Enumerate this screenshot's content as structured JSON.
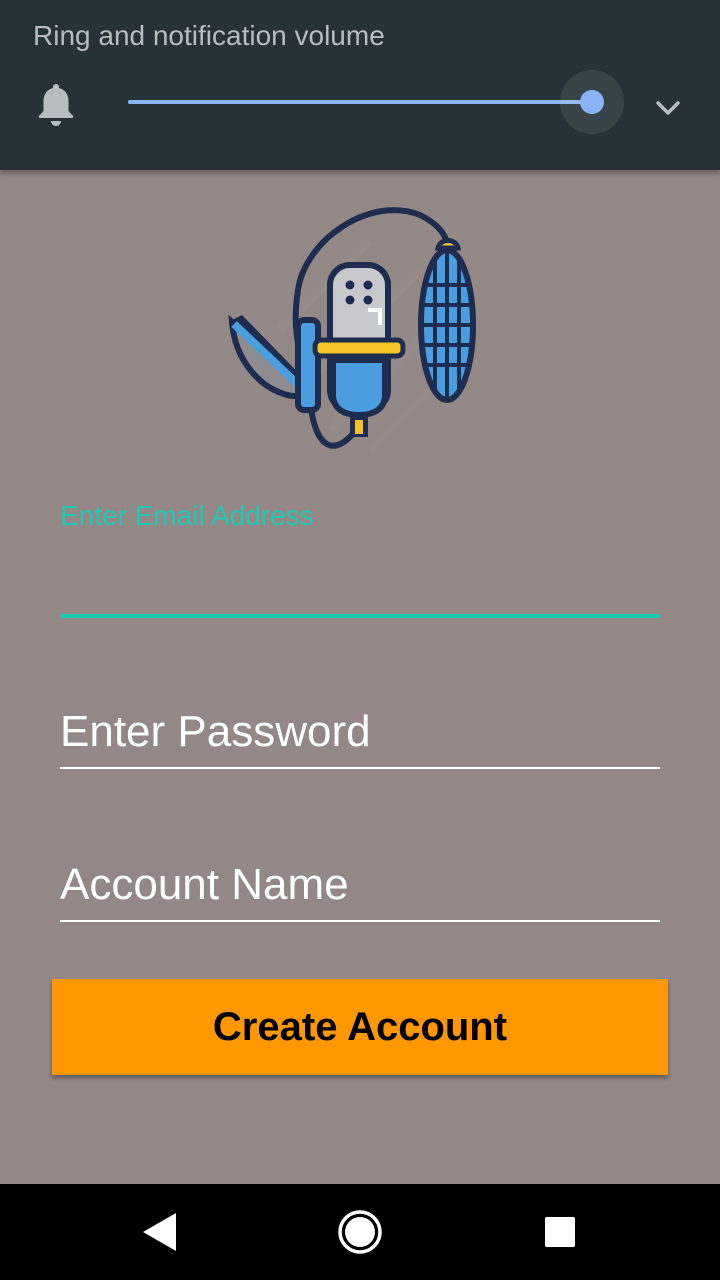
{
  "volume_panel": {
    "title": "Ring and notification volume",
    "level": 1.0,
    "icon": "bell-icon",
    "expand_icon": "chevron-down-icon",
    "accent_color": "#8ab4f8"
  },
  "logo": {
    "icon": "microphone-logo-icon"
  },
  "form": {
    "email_label": "Enter Email Address",
    "email_value": "",
    "password_placeholder": "Enter Password",
    "account_placeholder": "Account Name",
    "create_button_label": "Create Account",
    "accent_color": "#21c7b5",
    "button_color": "#ff9800"
  },
  "nav": {
    "back_icon": "back-triangle-icon",
    "home_icon": "home-circle-icon",
    "recents_icon": "recents-square-icon"
  }
}
